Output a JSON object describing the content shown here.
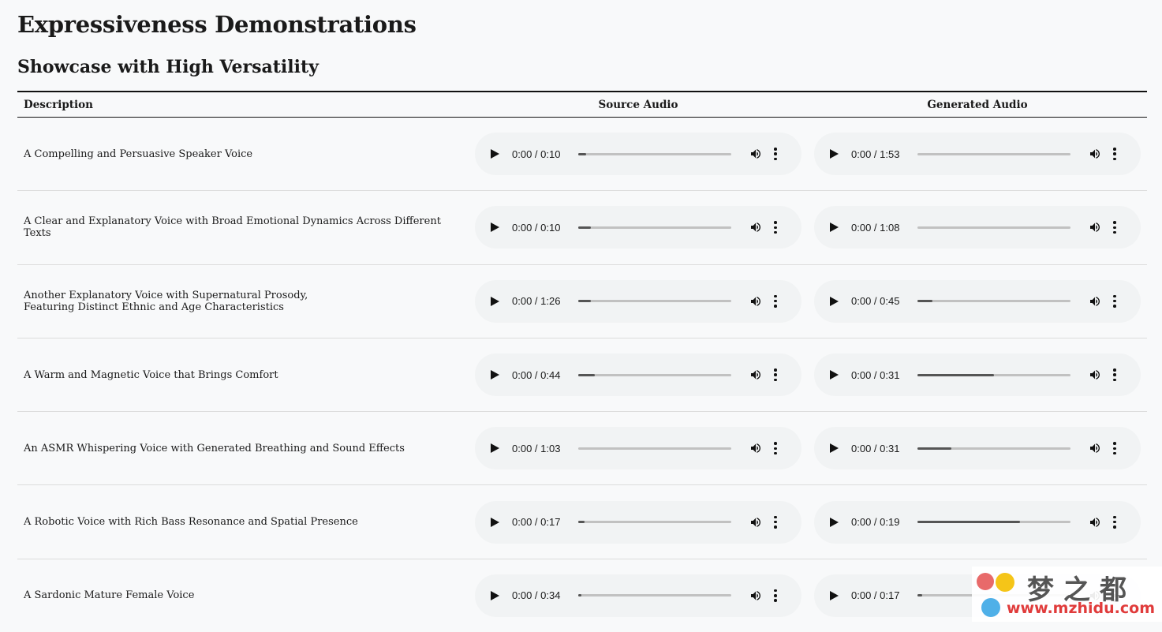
{
  "title": "Expressiveness Demonstrations",
  "subtitle": "Showcase with High Versatility",
  "table": {
    "headers": {
      "description": "Description",
      "source": "Source Audio",
      "generated": "Generated Audio"
    },
    "rows": [
      {
        "description": [
          "A Compelling and Persuasive Speaker Voice"
        ],
        "source": {
          "time": "0:00 / 0:10",
          "progress": 0.05
        },
        "generated": {
          "time": "0:00 / 1:53",
          "progress": 0.0
        }
      },
      {
        "description": [
          "A Clear and Explanatory Voice with Broad Emotional Dynamics Across Different Texts"
        ],
        "source": {
          "time": "0:00 / 0:10",
          "progress": 0.08
        },
        "generated": {
          "time": "0:00 / 1:08",
          "progress": 0.0
        }
      },
      {
        "description": [
          "Another Explanatory Voice with Supernatural Prosody,",
          "Featuring Distinct Ethnic and Age Characteristics"
        ],
        "source": {
          "time": "0:00 / 1:26",
          "progress": 0.08
        },
        "generated": {
          "time": "0:00 / 0:45",
          "progress": 0.1
        }
      },
      {
        "description": [
          "A Warm and Magnetic Voice that Brings Comfort"
        ],
        "source": {
          "time": "0:00 / 0:44",
          "progress": 0.11
        },
        "generated": {
          "time": "0:00 / 0:31",
          "progress": 0.5
        }
      },
      {
        "description": [
          "An ASMR Whispering Voice with Generated Breathing and Sound Effects"
        ],
        "source": {
          "time": "0:00 / 1:03",
          "progress": 0.0
        },
        "generated": {
          "time": "0:00 / 0:31",
          "progress": 0.22
        }
      },
      {
        "description": [
          "A Robotic Voice with Rich Bass Resonance and Spatial Presence"
        ],
        "source": {
          "time": "0:00 / 0:17",
          "progress": 0.04
        },
        "generated": {
          "time": "0:00 / 0:19",
          "progress": 0.67
        }
      },
      {
        "description": [
          "A Sardonic Mature Female Voice"
        ],
        "source": {
          "time": "0:00 / 0:34",
          "progress": 0.02
        },
        "generated": {
          "time": "0:00 / 0:17",
          "progress": 0.03
        }
      }
    ]
  },
  "watermark": {
    "text": "梦之都",
    "url": "www.mzhidu.com"
  },
  "colors": {
    "player_bg": "#f1f3f4",
    "track": "#c1c1c1",
    "track_fill": "#555555",
    "watermark_red": "#e03b3b"
  }
}
